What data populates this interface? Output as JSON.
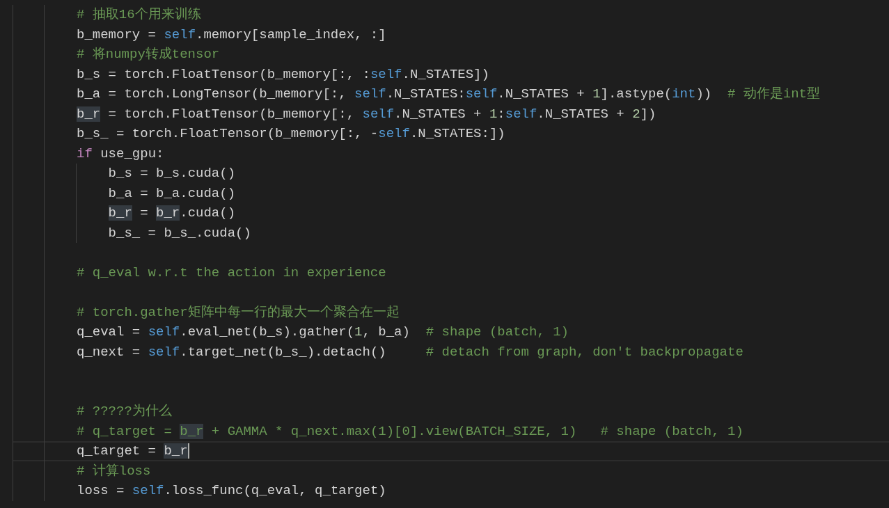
{
  "editor": {
    "lines": [
      {
        "kind": "code",
        "current": false,
        "tokens": [
          {
            "kind": "comment",
            "text": "# 抽取16个用来训练"
          }
        ]
      },
      {
        "kind": "code",
        "current": false,
        "tokens": [
          {
            "kind": "plain",
            "text": "b_memory = "
          },
          {
            "kind": "self",
            "text": "self"
          },
          {
            "kind": "plain",
            "text": ".memory[sample_index, :]"
          }
        ]
      },
      {
        "kind": "code",
        "current": false,
        "tokens": [
          {
            "kind": "comment",
            "text": "# 将numpy转成tensor"
          }
        ]
      },
      {
        "kind": "code",
        "current": false,
        "tokens": [
          {
            "kind": "plain",
            "text": "b_s = torch.FloatTensor(b_memory[:, :"
          },
          {
            "kind": "self",
            "text": "self"
          },
          {
            "kind": "plain",
            "text": ".N_STATES])"
          }
        ]
      },
      {
        "kind": "code",
        "current": false,
        "tokens": [
          {
            "kind": "plain",
            "text": "b_a = torch.LongTensor(b_memory[:, "
          },
          {
            "kind": "self",
            "text": "self"
          },
          {
            "kind": "plain",
            "text": ".N_STATES:"
          },
          {
            "kind": "self",
            "text": "self"
          },
          {
            "kind": "plain",
            "text": ".N_STATES + "
          },
          {
            "kind": "number",
            "text": "1"
          },
          {
            "kind": "plain",
            "text": "].astype("
          },
          {
            "kind": "self",
            "text": "int"
          },
          {
            "kind": "plain",
            "text": "))  "
          },
          {
            "kind": "comment",
            "text": "# 动作是int型"
          }
        ]
      },
      {
        "kind": "code",
        "current": false,
        "tokens": [
          {
            "kind": "match",
            "text": "b_r"
          },
          {
            "kind": "plain",
            "text": " = torch.FloatTensor(b_memory[:, "
          },
          {
            "kind": "self",
            "text": "self"
          },
          {
            "kind": "plain",
            "text": ".N_STATES + "
          },
          {
            "kind": "number",
            "text": "1"
          },
          {
            "kind": "plain",
            "text": ":"
          },
          {
            "kind": "self",
            "text": "self"
          },
          {
            "kind": "plain",
            "text": ".N_STATES + "
          },
          {
            "kind": "number",
            "text": "2"
          },
          {
            "kind": "plain",
            "text": "])"
          }
        ]
      },
      {
        "kind": "code",
        "current": false,
        "tokens": [
          {
            "kind": "plain",
            "text": "b_s_ = torch.FloatTensor(b_memory[:, -"
          },
          {
            "kind": "self",
            "text": "self"
          },
          {
            "kind": "plain",
            "text": ".N_STATES:])"
          }
        ]
      },
      {
        "kind": "code",
        "current": false,
        "tokens": [
          {
            "kind": "control",
            "text": "if"
          },
          {
            "kind": "plain",
            "text": " use_gpu:"
          }
        ]
      },
      {
        "kind": "code",
        "current": false,
        "tokens": [
          {
            "kind": "plain",
            "text": "    b_s = b_s.cuda()"
          }
        ]
      },
      {
        "kind": "code",
        "current": false,
        "tokens": [
          {
            "kind": "plain",
            "text": "    b_a = b_a.cuda()"
          }
        ]
      },
      {
        "kind": "code",
        "current": false,
        "tokens": [
          {
            "kind": "match",
            "text": "    b_r"
          },
          {
            "kind": "plain",
            "text": " = "
          },
          {
            "kind": "match",
            "text": "b_r"
          },
          {
            "kind": "plain",
            "text": ".cuda()"
          }
        ]
      },
      {
        "kind": "code",
        "current": false,
        "tokens": [
          {
            "kind": "plain",
            "text": "    b_s_ = b_s_.cuda()"
          }
        ]
      },
      {
        "kind": "blank",
        "current": false
      },
      {
        "kind": "code",
        "current": false,
        "tokens": [
          {
            "kind": "comment",
            "text": "# q_eval w.r.t the action in experience"
          }
        ]
      },
      {
        "kind": "blank",
        "current": false
      },
      {
        "kind": "code",
        "current": false,
        "tokens": [
          {
            "kind": "comment",
            "text": "# torch.gather矩阵中每一行的最大一个聚合在一起"
          }
        ]
      },
      {
        "kind": "code",
        "current": false,
        "tokens": [
          {
            "kind": "plain",
            "text": "q_eval = "
          },
          {
            "kind": "self",
            "text": "self"
          },
          {
            "kind": "plain",
            "text": ".eval_net(b_s).gather("
          },
          {
            "kind": "number",
            "text": "1"
          },
          {
            "kind": "plain",
            "text": ", b_a)  "
          },
          {
            "kind": "comment",
            "text": "# shape (batch, 1)"
          }
        ]
      },
      {
        "kind": "code",
        "current": false,
        "tokens": [
          {
            "kind": "plain",
            "text": "q_next = "
          },
          {
            "kind": "self",
            "text": "self"
          },
          {
            "kind": "plain",
            "text": ".target_net(b_s_).detach()     "
          },
          {
            "kind": "comment",
            "text": "# detach from graph, don't backpropagate"
          }
        ]
      },
      {
        "kind": "blank",
        "current": false
      },
      {
        "kind": "blank",
        "current": false
      },
      {
        "kind": "code",
        "current": false,
        "tokens": [
          {
            "kind": "comment",
            "text": "# ?????为什么"
          }
        ]
      },
      {
        "kind": "code",
        "current": false,
        "tokens": [
          {
            "kind": "comment",
            "text": "# q_target = "
          },
          {
            "kind": "match-comment",
            "text": "b_r"
          },
          {
            "kind": "comment",
            "text": " + GAMMA * q_next.max(1)[0].view(BATCH_SIZE, 1)   # shape (batch, 1)"
          }
        ]
      },
      {
        "kind": "code",
        "current": true,
        "tokens": [
          {
            "kind": "plain",
            "text": "q_target = "
          },
          {
            "kind": "match",
            "text": "b_r"
          }
        ]
      },
      {
        "kind": "code",
        "current": false,
        "tokens": [
          {
            "kind": "comment",
            "text": "# 计算loss"
          }
        ]
      },
      {
        "kind": "code",
        "current": false,
        "tokens": [
          {
            "kind": "plain",
            "text": "loss = "
          },
          {
            "kind": "self",
            "text": "self"
          },
          {
            "kind": "plain",
            "text": ".loss_func(q_eval, q_target)"
          }
        ]
      }
    ]
  }
}
